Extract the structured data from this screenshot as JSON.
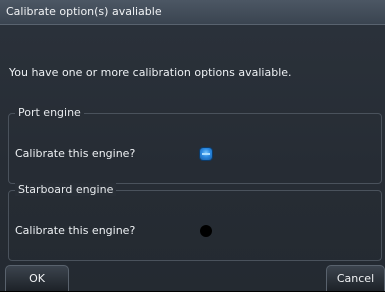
{
  "dialog": {
    "title": "Calibrate option(s) avaliable",
    "message": "You have one or more calibration options avaliable."
  },
  "groups": [
    {
      "legend": "Port engine",
      "label": "Calibrate this engine?",
      "checked": true
    },
    {
      "legend": "Starboard engine",
      "label": "Calibrate this engine?",
      "checked": false
    }
  ],
  "softkeys": {
    "ok_label": "OK",
    "cancel_label": "Cancel"
  },
  "colors": {
    "checked_accent": "#2a88e0",
    "background": "#262c34",
    "titlebar": "#4c5764"
  }
}
